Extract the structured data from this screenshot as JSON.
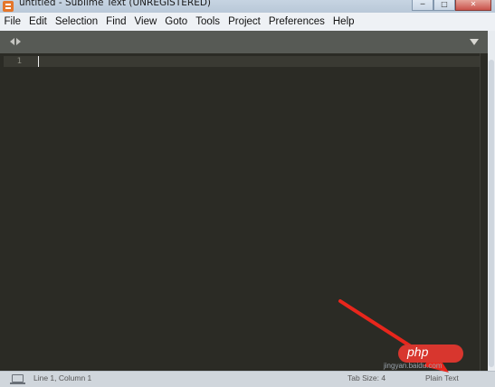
{
  "window": {
    "title": "untitled - Sublime Text (UNREGISTERED)",
    "controls": [
      "─",
      "□",
      "✕"
    ]
  },
  "menu": [
    "File",
    "Edit",
    "Selection",
    "Find",
    "View",
    "Goto",
    "Tools",
    "Project",
    "Preferences",
    "Help"
  ],
  "editor": {
    "line_numbers": [
      "1"
    ],
    "content": ""
  },
  "status": {
    "position": "Line 1, Column 1",
    "tab_size": "Tab Size: 4",
    "syntax": "Plain Text"
  },
  "watermark": {
    "logo": "php",
    "subtext": "jingyan.baidu.com"
  },
  "colors": {
    "editor_bg": "#2b2b25",
    "annotation_arrow": "#e8261c"
  }
}
